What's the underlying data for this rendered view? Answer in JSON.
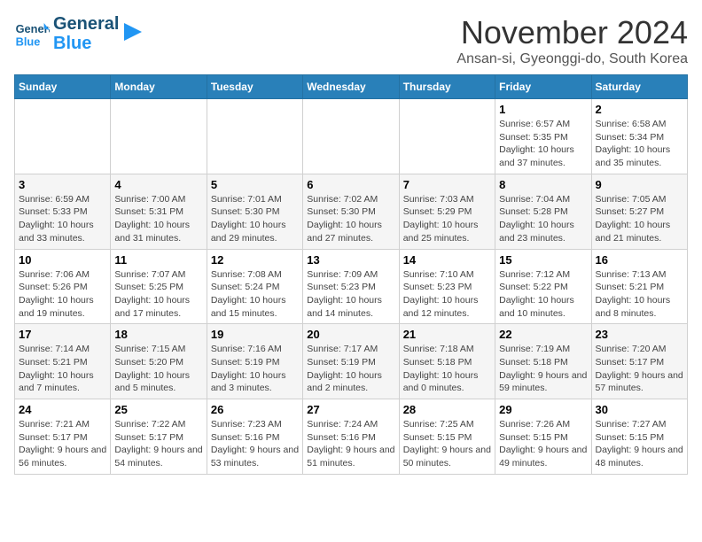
{
  "header": {
    "logo_general": "General",
    "logo_blue": "Blue",
    "month_title": "November 2024",
    "subtitle": "Ansan-si, Gyeonggi-do, South Korea"
  },
  "columns": [
    "Sunday",
    "Monday",
    "Tuesday",
    "Wednesday",
    "Thursday",
    "Friday",
    "Saturday"
  ],
  "weeks": [
    {
      "days": [
        {
          "num": "",
          "info": ""
        },
        {
          "num": "",
          "info": ""
        },
        {
          "num": "",
          "info": ""
        },
        {
          "num": "",
          "info": ""
        },
        {
          "num": "",
          "info": ""
        },
        {
          "num": "1",
          "info": "Sunrise: 6:57 AM\nSunset: 5:35 PM\nDaylight: 10 hours and 37 minutes."
        },
        {
          "num": "2",
          "info": "Sunrise: 6:58 AM\nSunset: 5:34 PM\nDaylight: 10 hours and 35 minutes."
        }
      ]
    },
    {
      "days": [
        {
          "num": "3",
          "info": "Sunrise: 6:59 AM\nSunset: 5:33 PM\nDaylight: 10 hours and 33 minutes."
        },
        {
          "num": "4",
          "info": "Sunrise: 7:00 AM\nSunset: 5:31 PM\nDaylight: 10 hours and 31 minutes."
        },
        {
          "num": "5",
          "info": "Sunrise: 7:01 AM\nSunset: 5:30 PM\nDaylight: 10 hours and 29 minutes."
        },
        {
          "num": "6",
          "info": "Sunrise: 7:02 AM\nSunset: 5:30 PM\nDaylight: 10 hours and 27 minutes."
        },
        {
          "num": "7",
          "info": "Sunrise: 7:03 AM\nSunset: 5:29 PM\nDaylight: 10 hours and 25 minutes."
        },
        {
          "num": "8",
          "info": "Sunrise: 7:04 AM\nSunset: 5:28 PM\nDaylight: 10 hours and 23 minutes."
        },
        {
          "num": "9",
          "info": "Sunrise: 7:05 AM\nSunset: 5:27 PM\nDaylight: 10 hours and 21 minutes."
        }
      ]
    },
    {
      "days": [
        {
          "num": "10",
          "info": "Sunrise: 7:06 AM\nSunset: 5:26 PM\nDaylight: 10 hours and 19 minutes."
        },
        {
          "num": "11",
          "info": "Sunrise: 7:07 AM\nSunset: 5:25 PM\nDaylight: 10 hours and 17 minutes."
        },
        {
          "num": "12",
          "info": "Sunrise: 7:08 AM\nSunset: 5:24 PM\nDaylight: 10 hours and 15 minutes."
        },
        {
          "num": "13",
          "info": "Sunrise: 7:09 AM\nSunset: 5:23 PM\nDaylight: 10 hours and 14 minutes."
        },
        {
          "num": "14",
          "info": "Sunrise: 7:10 AM\nSunset: 5:23 PM\nDaylight: 10 hours and 12 minutes."
        },
        {
          "num": "15",
          "info": "Sunrise: 7:12 AM\nSunset: 5:22 PM\nDaylight: 10 hours and 10 minutes."
        },
        {
          "num": "16",
          "info": "Sunrise: 7:13 AM\nSunset: 5:21 PM\nDaylight: 10 hours and 8 minutes."
        }
      ]
    },
    {
      "days": [
        {
          "num": "17",
          "info": "Sunrise: 7:14 AM\nSunset: 5:21 PM\nDaylight: 10 hours and 7 minutes."
        },
        {
          "num": "18",
          "info": "Sunrise: 7:15 AM\nSunset: 5:20 PM\nDaylight: 10 hours and 5 minutes."
        },
        {
          "num": "19",
          "info": "Sunrise: 7:16 AM\nSunset: 5:19 PM\nDaylight: 10 hours and 3 minutes."
        },
        {
          "num": "20",
          "info": "Sunrise: 7:17 AM\nSunset: 5:19 PM\nDaylight: 10 hours and 2 minutes."
        },
        {
          "num": "21",
          "info": "Sunrise: 7:18 AM\nSunset: 5:18 PM\nDaylight: 10 hours and 0 minutes."
        },
        {
          "num": "22",
          "info": "Sunrise: 7:19 AM\nSunset: 5:18 PM\nDaylight: 9 hours and 59 minutes."
        },
        {
          "num": "23",
          "info": "Sunrise: 7:20 AM\nSunset: 5:17 PM\nDaylight: 9 hours and 57 minutes."
        }
      ]
    },
    {
      "days": [
        {
          "num": "24",
          "info": "Sunrise: 7:21 AM\nSunset: 5:17 PM\nDaylight: 9 hours and 56 minutes."
        },
        {
          "num": "25",
          "info": "Sunrise: 7:22 AM\nSunset: 5:17 PM\nDaylight: 9 hours and 54 minutes."
        },
        {
          "num": "26",
          "info": "Sunrise: 7:23 AM\nSunset: 5:16 PM\nDaylight: 9 hours and 53 minutes."
        },
        {
          "num": "27",
          "info": "Sunrise: 7:24 AM\nSunset: 5:16 PM\nDaylight: 9 hours and 51 minutes."
        },
        {
          "num": "28",
          "info": "Sunrise: 7:25 AM\nSunset: 5:15 PM\nDaylight: 9 hours and 50 minutes."
        },
        {
          "num": "29",
          "info": "Sunrise: 7:26 AM\nSunset: 5:15 PM\nDaylight: 9 hours and 49 minutes."
        },
        {
          "num": "30",
          "info": "Sunrise: 7:27 AM\nSunset: 5:15 PM\nDaylight: 9 hours and 48 minutes."
        }
      ]
    }
  ]
}
